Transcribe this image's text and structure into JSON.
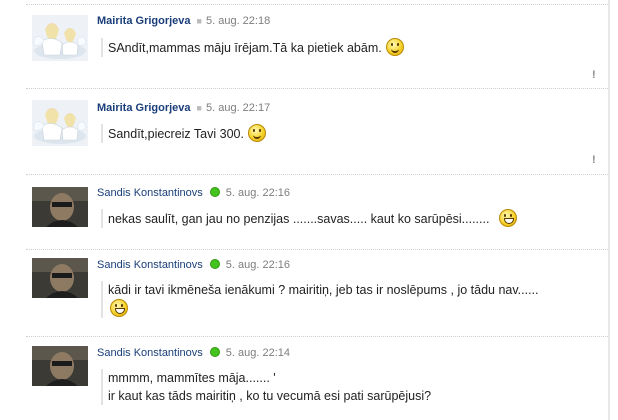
{
  "posts": [
    {
      "author": "Mairita Grigorjeva",
      "time": "5. aug. 22:18",
      "text": "SAndīt,mammas māju īrējam.Tā ka pietiek abām.",
      "smiley": "wink-smiley",
      "online": false,
      "report": "!"
    },
    {
      "author": "Mairita Grigorjeva",
      "time": "5. aug. 22:17",
      "text": "Sandīt,piecreiz Tavi 300.",
      "smiley": "wink-smiley",
      "online": false,
      "report": "!"
    },
    {
      "author": "Sandis Konstantinovs",
      "time": "5. aug. 22:16",
      "text": "nekas saulīt, gan jau no penzijas .......savas..... kaut ko sarūpēsi........",
      "smiley": "grin-smiley",
      "online": true
    },
    {
      "author": "Sandis Konstantinovs",
      "time": "5. aug. 22:16",
      "text": "kādi ir tavi ikmēneša ienākumi ? mairitiņ, jeb tas ir noslēpums , jo tādu nav......",
      "smiley": "grin-smiley",
      "online": true
    },
    {
      "author": "Sandis Konstantinovs",
      "time": "5. aug. 22:14",
      "text_line1": "mmmm, mammītes māja....... '",
      "text_line2": "ir kaut kas tāds mairitiņ , ko tu vecumā esi pati sarūpējusi?",
      "online": true
    }
  ]
}
